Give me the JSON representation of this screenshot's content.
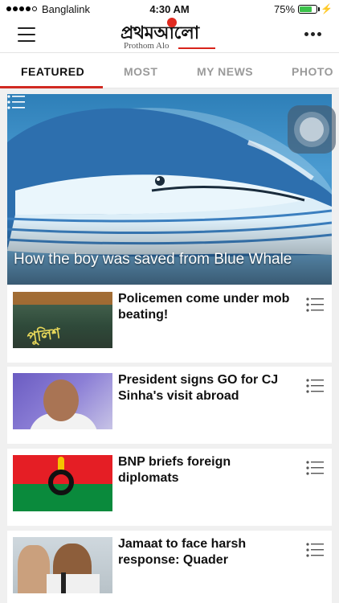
{
  "status_bar": {
    "carrier": "Banglalink",
    "time": "4:30 AM",
    "battery_percent": "75%",
    "battery_level": 0.75,
    "signal_bars_filled": 4,
    "signal_bars_total": 5
  },
  "header": {
    "logo_title": "প্রথমআলো",
    "logo_subtitle": "Prothom Alo"
  },
  "tabs": [
    {
      "label": "FEATURED",
      "active": true
    },
    {
      "label": "MOST",
      "active": false
    },
    {
      "label": "MY NEWS",
      "active": false
    },
    {
      "label": "PHOTO",
      "active": false
    }
  ],
  "hero": {
    "title": "How the boy was saved from Blue Whale"
  },
  "articles": [
    {
      "headline": "Policemen come under mob beating!",
      "thumb_text": "পুলিশ"
    },
    {
      "headline": "President signs GO for CJ Sinha's visit abroad"
    },
    {
      "headline": "BNP briefs foreign diplomats"
    },
    {
      "headline": "Jamaat to face harsh response: Quader"
    }
  ],
  "colors": {
    "accent": "#d12a22",
    "battery_fill": "#3bc24a"
  }
}
